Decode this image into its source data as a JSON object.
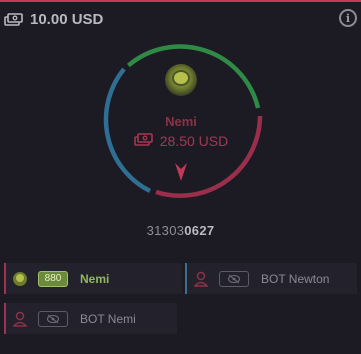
{
  "header": {
    "balance_icon": "money-stack-icon",
    "balance": "10.00 USD",
    "info_icon": "info-icon",
    "info_glyph": "i"
  },
  "wheel": {
    "segments": [
      {
        "color": "#2f8a45"
      },
      {
        "color": "#9a2f4b"
      },
      {
        "color": "#2f6f94"
      }
    ],
    "pointer_icon": "pointer-arrow-icon",
    "pointer_color": "#c03a58"
  },
  "winner": {
    "avatar_icon": "avatar-icon",
    "name": "Nemi",
    "amount_icon": "money-stack-icon",
    "amount": "28.50 USD",
    "name_color": "#8a3346",
    "amount_color": "#a33852"
  },
  "round": {
    "prefix": "31303",
    "suffix": "0627"
  },
  "players": [
    {
      "name": "Nemi",
      "badge": "880",
      "icon": "avatar-icon",
      "accent": "#a0334e"
    },
    {
      "name": "BOT Newton",
      "badge_icon": "eye-off-icon",
      "icon": "bot-user-icon",
      "accent": "#3a6f92"
    },
    {
      "name": "BOT Nemi",
      "badge_icon": "eye-off-icon",
      "icon": "bot-user-icon",
      "accent": "#9b3458"
    }
  ]
}
